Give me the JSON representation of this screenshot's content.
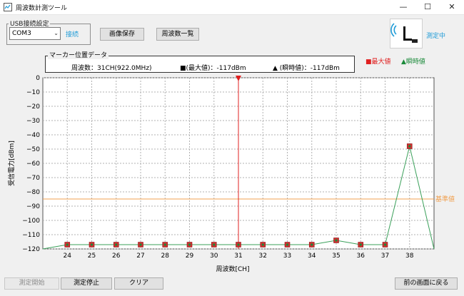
{
  "window": {
    "title": "周波数計測ツール",
    "minimize_glyph": "—",
    "maximize_glyph": "☐",
    "close_glyph": "✕"
  },
  "usb": {
    "group_label": "USB接続設定",
    "port_value": "COM3",
    "connect_label": "接続"
  },
  "toolbar": {
    "save_image": "画像保存",
    "frequency_list": "周波数一覧"
  },
  "status": {
    "measuring_label": "測定中"
  },
  "marker": {
    "legend": "マーカー位置データ",
    "frequency": "周波数：31CH(922.0MHz)",
    "max_value": "■(最大値)：-117dBm",
    "instant_value": "▲ (瞬時値)：-117dBm"
  },
  "legend": {
    "max": "■最大値",
    "instant": "▲瞬時値"
  },
  "buttons": {
    "start": "測定開始",
    "stop": "測定停止",
    "clear": "クリア",
    "back": "前の画面に戻る"
  },
  "colors": {
    "max": "#e02020",
    "instant": "#1a8a3a",
    "marker": "#e02020",
    "reference": "#f0a050",
    "accent": "#1e9bd7"
  },
  "chart_data": {
    "type": "line",
    "xlabel": "周波数[CH]",
    "ylabel": "受信電力[dBm]",
    "xlim": [
      23,
      39
    ],
    "ylim": [
      -120,
      0
    ],
    "x_ticks": [
      24,
      25,
      26,
      27,
      28,
      29,
      30,
      31,
      32,
      33,
      34,
      35,
      36,
      37,
      38
    ],
    "y_ticks": [
      0,
      -10,
      -20,
      -30,
      -40,
      -50,
      -60,
      -70,
      -80,
      -90,
      -100,
      -110,
      -120
    ],
    "grid": true,
    "reference_line": {
      "value": -85,
      "label": "基準値"
    },
    "marker_line": {
      "x": 31
    },
    "series": [
      {
        "name": "最大値",
        "x": [
          24,
          25,
          26,
          27,
          28,
          29,
          30,
          31,
          32,
          33,
          34,
          35,
          36,
          37,
          38
        ],
        "values": [
          -117,
          -117,
          -117,
          -117,
          -117,
          -117,
          -117,
          -117,
          -117,
          -117,
          -117,
          -114,
          -117,
          -117,
          -48
        ]
      },
      {
        "name": "瞬時値",
        "x": [
          23,
          24,
          25,
          26,
          27,
          28,
          29,
          30,
          31,
          32,
          33,
          34,
          35,
          36,
          37,
          38,
          39
        ],
        "values": [
          -120,
          -117,
          -117,
          -117,
          -117,
          -117,
          -117,
          -117,
          -117,
          -117,
          -117,
          -117,
          -114,
          -117,
          -117,
          -48,
          -120
        ]
      }
    ]
  }
}
